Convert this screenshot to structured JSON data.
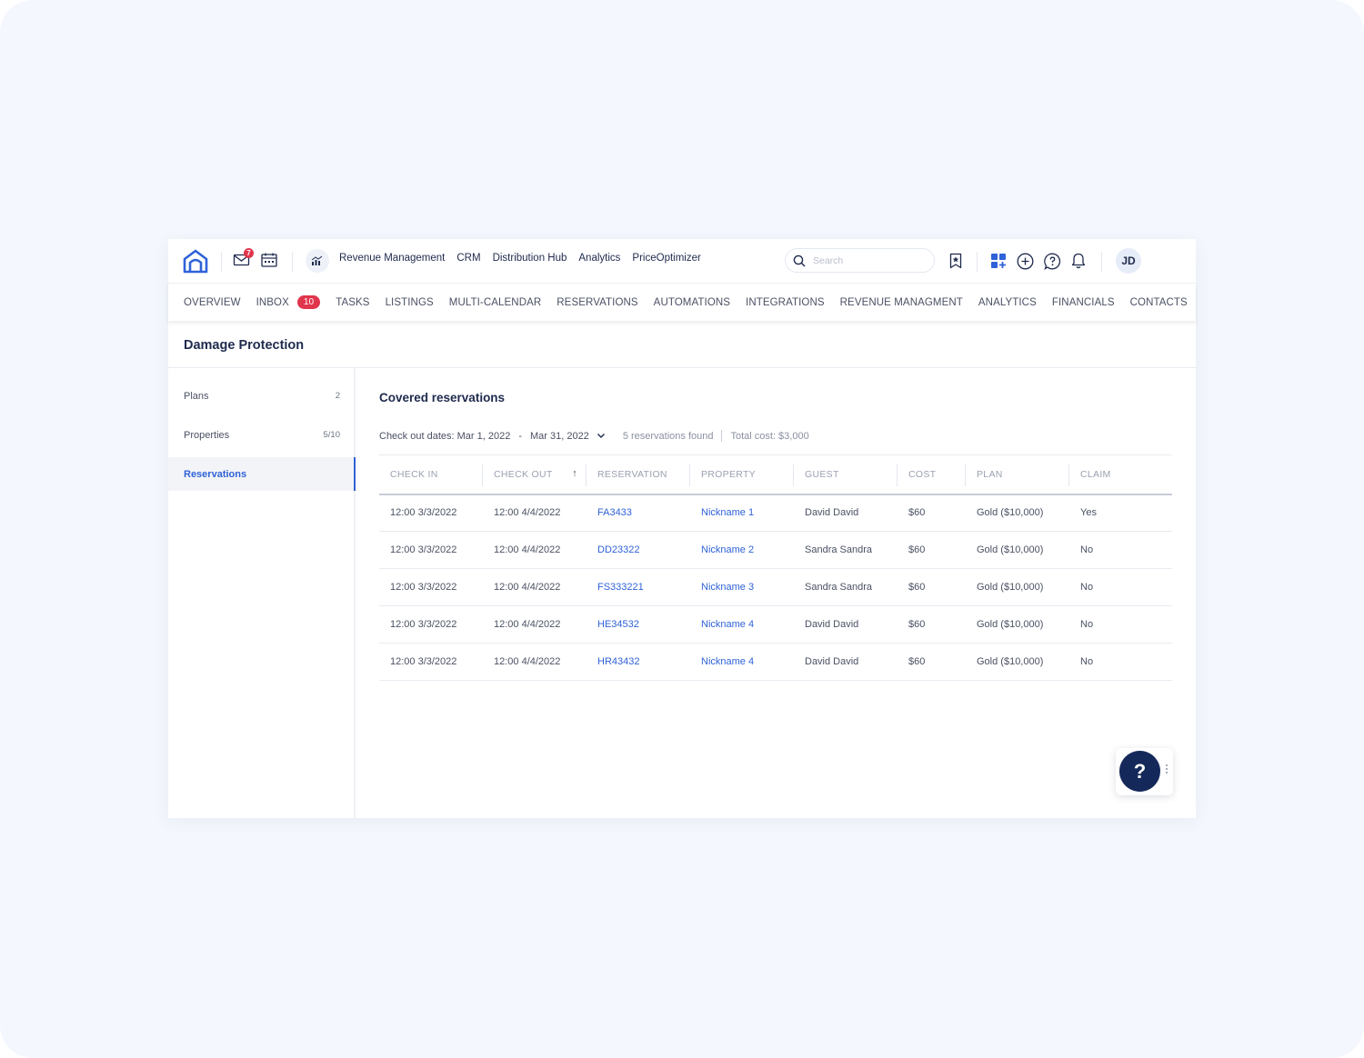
{
  "colors": {
    "accent": "#2f62d8",
    "badge": "#e0354c",
    "navy": "#1f2a4d",
    "help_button": "#14295a"
  },
  "topbar": {
    "logo_icon": "home-logo-icon",
    "mail_badge": "7",
    "links": [
      "Revenue Management",
      "CRM",
      "Distribution Hub",
      "Analytics",
      "PriceOptimizer"
    ],
    "search_placeholder": "Search",
    "avatar_initials": "JD"
  },
  "nav": {
    "items": [
      "OVERVIEW",
      "INBOX",
      "TASKS",
      "LISTINGS",
      "MULTI-CALENDAR",
      "RESERVATIONS",
      "AUTOMATIONS",
      "INTEGRATIONS",
      "REVENUE MANAGMENT",
      "ANALYTICS",
      "FINANCIALS",
      "CONTACTS"
    ],
    "inbox_count": "10"
  },
  "page": {
    "title": "Damage Protection"
  },
  "sidebar": {
    "items": [
      {
        "label": "Plans",
        "count": "2"
      },
      {
        "label": "Properties",
        "count": "5/10"
      },
      {
        "label": "Reservations",
        "count": ""
      }
    ],
    "active": "Reservations"
  },
  "main": {
    "title": "Covered reservations",
    "filters": {
      "label": "Check out dates: Mar 1, 2022",
      "dash": "-",
      "end_date": "Mar 31, 2022",
      "found": "5 reservations found",
      "total": "Total cost: $3,000"
    },
    "columns": [
      "CHECK IN",
      "CHECK OUT",
      "RESERVATION",
      "PROPERTY",
      "GUEST",
      "COST",
      "PLAN",
      "CLAIM"
    ],
    "sorted_column": "CHECK OUT",
    "rows": [
      [
        "12:00 3/3/2022",
        "12:00 4/4/2022",
        "FA3433",
        "Nickname 1",
        "David David",
        "$60",
        "Gold ($10,000)",
        "Yes"
      ],
      [
        "12:00 3/3/2022",
        "12:00 4/4/2022",
        "DD23322",
        "Nickname 2",
        "Sandra Sandra",
        "$60",
        "Gold ($10,000)",
        "No"
      ],
      [
        "12:00 3/3/2022",
        "12:00 4/4/2022",
        "FS333221",
        "Nickname 3",
        "Sandra Sandra",
        "$60",
        "Gold ($10,000)",
        "No"
      ],
      [
        "12:00 3/3/2022",
        "12:00 4/4/2022",
        "HE34532",
        "Nickname 4",
        "David David",
        "$60",
        "Gold ($10,000)",
        "No"
      ],
      [
        "12:00 3/3/2022",
        "12:00 4/4/2022",
        "HR43432",
        "Nickname 4",
        "David David",
        "$60",
        "Gold ($10,000)",
        "No"
      ]
    ]
  },
  "help": {
    "label": "?"
  }
}
